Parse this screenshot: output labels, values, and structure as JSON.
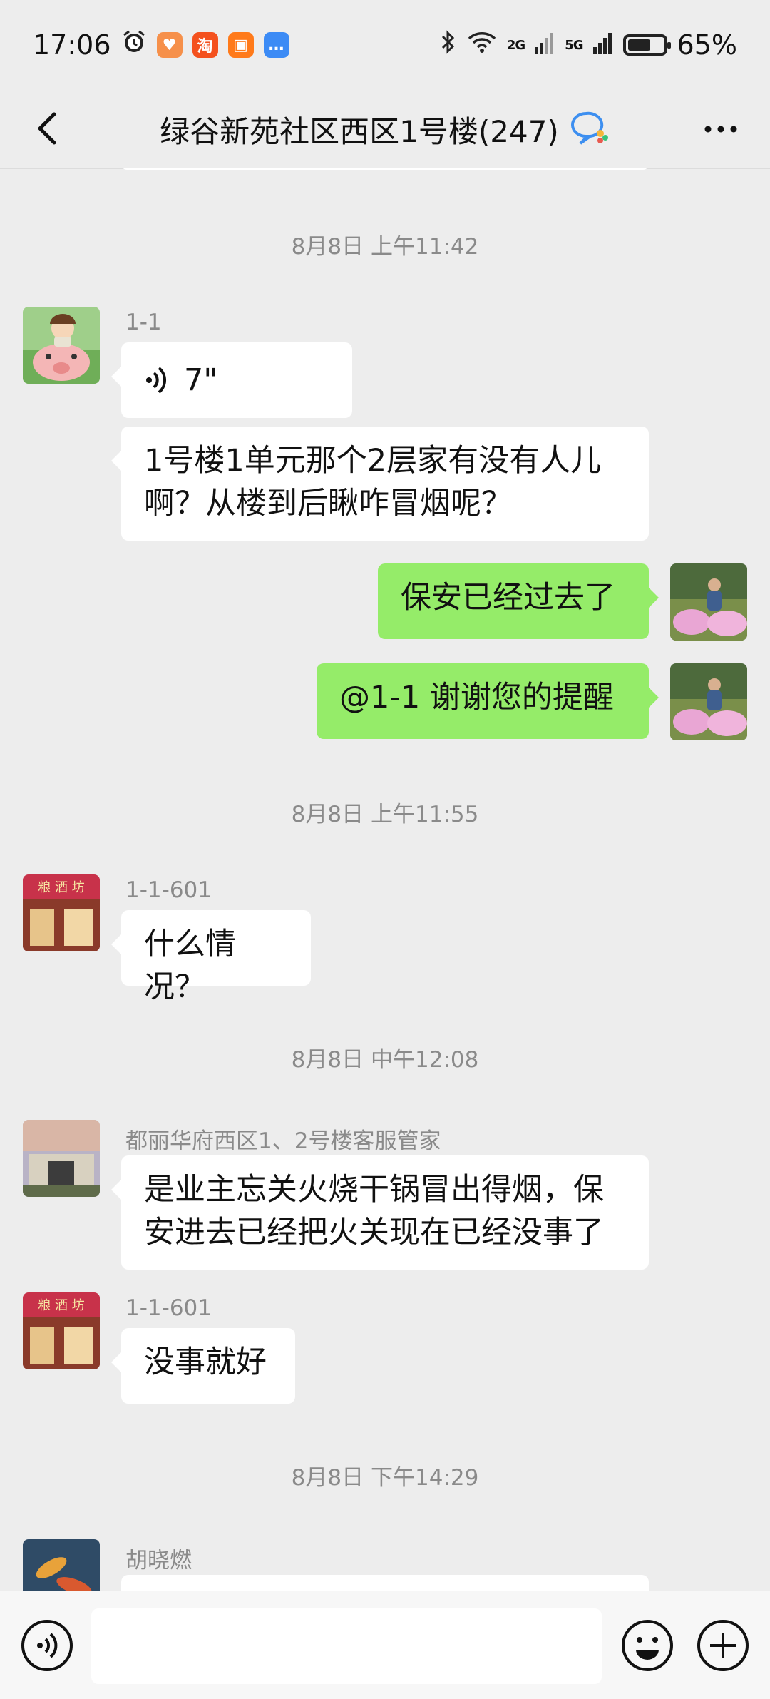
{
  "status": {
    "time": "17:06",
    "battery": "65%",
    "battery_level": 0.65,
    "network_2g": "2G",
    "network_5g": "5G",
    "app_icons": [
      "alarm-icon",
      "shopping-heart-icon",
      "taobao-icon",
      "bag-icon",
      "message-icon"
    ],
    "taobao_glyph": "淘"
  },
  "header": {
    "title": "绿谷新苑社区西区1号楼(247)",
    "title_icon": "group-chat-icon"
  },
  "messages": [
    {
      "type": "time",
      "text": "8月8日 上午11:42"
    },
    {
      "type": "voice",
      "sender": "1-1",
      "avatar": "pig-girl-avatar",
      "duration": "7\""
    },
    {
      "type": "text",
      "sender": "1-1",
      "text_line1": "1号楼1单元那个2层家有没有人儿",
      "text_line2": "啊？从楼到后瞅咋冒烟呢？"
    },
    {
      "type": "text-out",
      "text": "保安已经过去了"
    },
    {
      "type": "text-out",
      "text": "@1-1  谢谢您的提醒"
    },
    {
      "type": "time",
      "text": "8月8日 上午11:55"
    },
    {
      "type": "text",
      "sender": "1-1-601",
      "avatar": "wine-shop-avatar",
      "text": "什么情况？"
    },
    {
      "type": "time",
      "text": "8月8日 中午12:08"
    },
    {
      "type": "text",
      "sender": "都丽华府西区1、2号楼客服管家",
      "avatar": "building-avatar",
      "text_line1": "是业主忘关火烧干锅冒出得烟，保",
      "text_line2": "安进去已经把火关现在已经没事了"
    },
    {
      "type": "text",
      "sender": "1-1-601",
      "avatar": "wine-shop-avatar",
      "text": "没事就好"
    },
    {
      "type": "time",
      "text": "8月8日 下午14:29"
    },
    {
      "type": "text",
      "sender": "胡晓燃",
      "avatar": "koi-fish-avatar",
      "text": ""
    }
  ],
  "shop_sign": "粮 酒 坊",
  "input": {
    "value": "",
    "placeholder": ""
  },
  "colors": {
    "outgoing_bubble": "#95ec69",
    "incoming_bubble": "#ffffff",
    "background": "#ededed"
  }
}
